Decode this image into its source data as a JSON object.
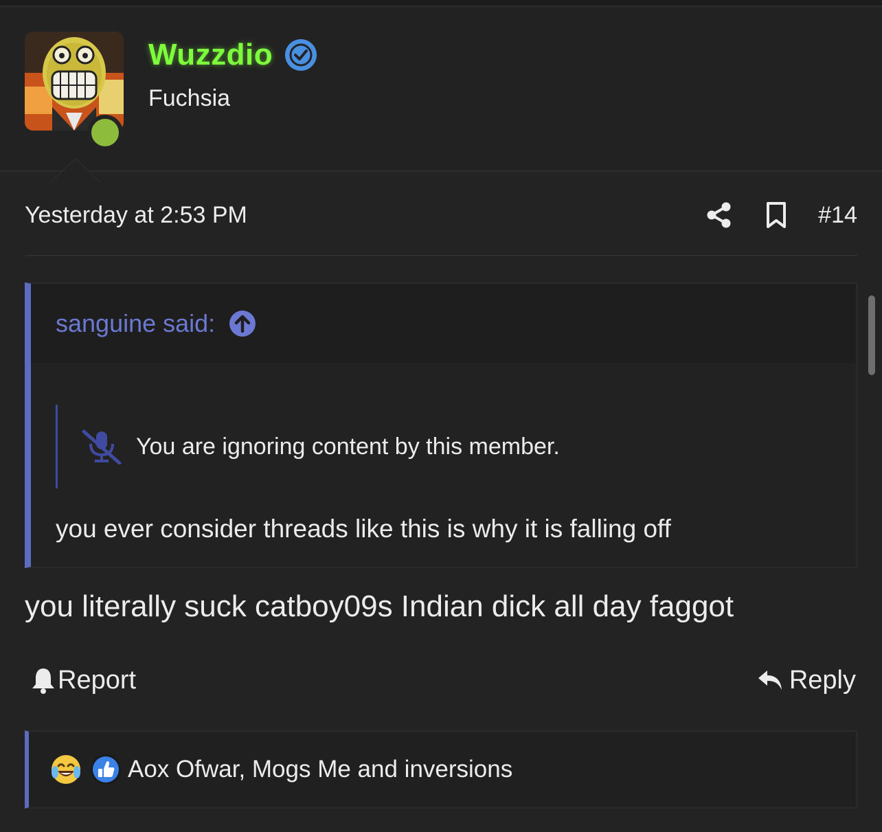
{
  "user": {
    "name": "Wuzzdio",
    "title": "Fuchsia",
    "verified_icon": "verified-check-icon",
    "online_color": "#8dbb3b",
    "name_color": "#7dff3c"
  },
  "post": {
    "timestamp": "Yesterday at 2:53 PM",
    "number": "#14",
    "body": "you literally suck catboy09s Indian dick all day faggot"
  },
  "quote": {
    "author_label": "sanguine said:",
    "ignored_notice": "You are ignoring content by this member.",
    "body": "you ever consider threads like this is why it is falling off",
    "accent_color": "#5d6bc0"
  },
  "actions": {
    "report_label": "Report",
    "reply_label": "Reply"
  },
  "reactions": {
    "icons": [
      "laugh-cry-icon",
      "like-icon"
    ],
    "users_text": "Aox Ofwar, Mogs Me and inversions"
  }
}
